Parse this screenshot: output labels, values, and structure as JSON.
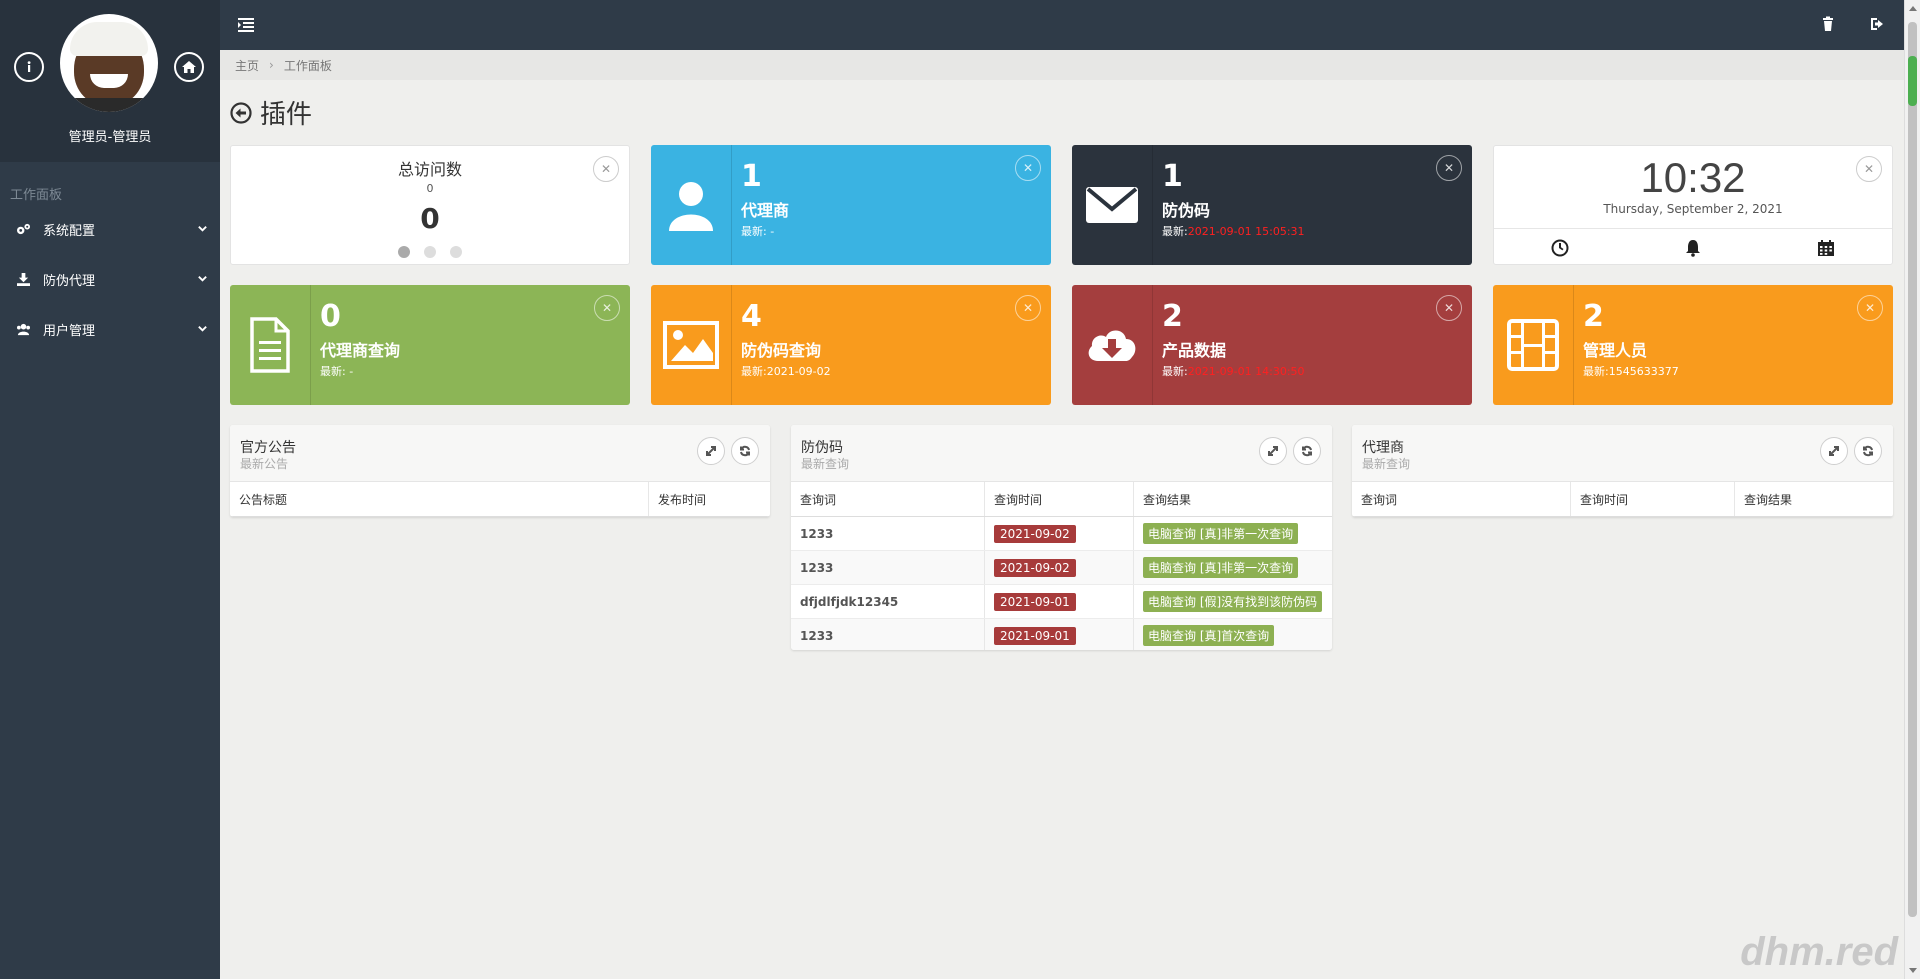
{
  "sidebar": {
    "profile_name": "管理员-管理员",
    "caption": "工作面板",
    "items": [
      {
        "label": "系统配置",
        "icon": "gears-icon"
      },
      {
        "label": "防伪代理",
        "icon": "download-icon"
      },
      {
        "label": "用户管理",
        "icon": "users-icon"
      }
    ]
  },
  "breadcrumb": {
    "home": "主页",
    "current": "工作面板"
  },
  "page": {
    "title": "插件"
  },
  "tiles": {
    "visits": {
      "title": "总访问数",
      "small": "0",
      "big": "0"
    },
    "agent": {
      "count": "1",
      "title": "代理商",
      "sub_prefix": "最新: -",
      "color": "#3ab3e2"
    },
    "code": {
      "count": "1",
      "title": "防伪码",
      "sub_prefix": "最新:",
      "sub_value": "2021-09-01 15:05:31",
      "color": "#2b333d"
    },
    "clock": {
      "time": "10:32",
      "date": "Thursday, September 2, 2021"
    },
    "agent_query": {
      "count": "0",
      "title": "代理商查询",
      "sub_prefix": "最新: -",
      "color": "#8cb556"
    },
    "code_query": {
      "count": "4",
      "title": "防伪码查询",
      "sub_prefix": "最新:2021-09-02",
      "color": "#f99b1d"
    },
    "product": {
      "count": "2",
      "title": "产品数据",
      "sub_prefix": "最新:",
      "sub_value": "2021-09-01 14:30:50",
      "color": "#a43e3e"
    },
    "admin": {
      "count": "2",
      "title": "管理人员",
      "sub_prefix": "最新:1545633377",
      "color": "#f99b1d"
    }
  },
  "panels": {
    "notice": {
      "title": "官方公告",
      "sub": "最新公告",
      "headers": [
        "公告标题",
        "发布时间"
      ]
    },
    "code": {
      "title": "防伪码",
      "sub": "最新查询",
      "headers": [
        "查询词",
        "查询时间",
        "查询结果"
      ],
      "rows": [
        {
          "word": "1233",
          "time": "2021-09-02",
          "result": "电脑查询 [真]非第一次查询"
        },
        {
          "word": "1233",
          "time": "2021-09-02",
          "result": "电脑查询 [真]非第一次查询"
        },
        {
          "word": "dfjdlfjdk12345",
          "time": "2021-09-01",
          "result": "电脑查询 [假]没有找到该防伪码"
        },
        {
          "word": "1233",
          "time": "2021-09-01",
          "result": "电脑查询 [真]首次查询"
        }
      ]
    },
    "agent": {
      "title": "代理商",
      "sub": "最新查询",
      "headers": [
        "查询词",
        "查询时间",
        "查询结果"
      ]
    }
  },
  "watermark": "dhm.red"
}
